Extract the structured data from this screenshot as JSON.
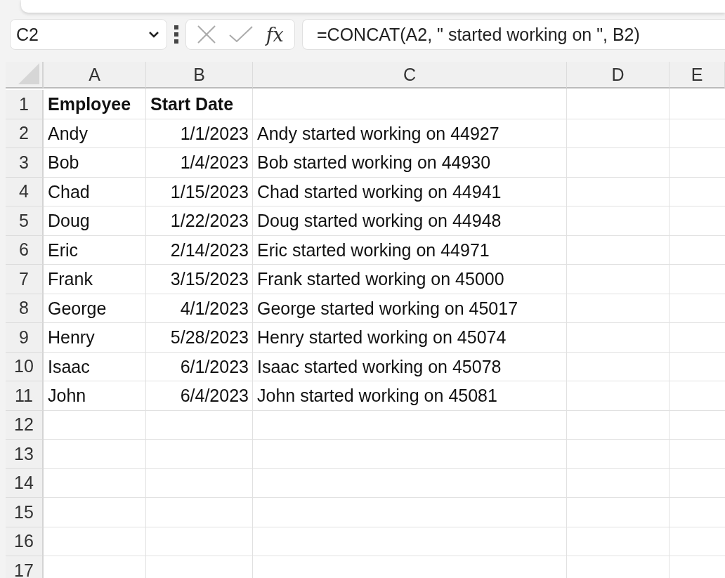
{
  "formula_bar": {
    "name_box": "C2",
    "function_label": "fx",
    "formula": "=CONCAT(A2, \" started working on \", B2)"
  },
  "sheet": {
    "columns": [
      "A",
      "B",
      "C",
      "D",
      "E"
    ],
    "header_row": {
      "number": "1",
      "cells": [
        "Employee",
        "Start Date"
      ]
    },
    "rows": [
      {
        "number": "2",
        "cells": [
          "Andy",
          "1/1/2023",
          "Andy started working on 44927"
        ]
      },
      {
        "number": "3",
        "cells": [
          "Bob",
          "1/4/2023",
          "Bob started working on 44930"
        ]
      },
      {
        "number": "4",
        "cells": [
          "Chad",
          "1/15/2023",
          "Chad started working on 44941"
        ]
      },
      {
        "number": "5",
        "cells": [
          "Doug",
          "1/22/2023",
          "Doug started working on 44948"
        ]
      },
      {
        "number": "6",
        "cells": [
          "Eric",
          "2/14/2023",
          "Eric started working on 44971"
        ]
      },
      {
        "number": "7",
        "cells": [
          "Frank",
          "3/15/2023",
          "Frank started working on 45000"
        ]
      },
      {
        "number": "8",
        "cells": [
          "George",
          "4/1/2023",
          "George started working on 45017"
        ]
      },
      {
        "number": "9",
        "cells": [
          "Henry",
          "5/28/2023",
          "Henry started working on 45074"
        ]
      },
      {
        "number": "10",
        "cells": [
          "Isaac",
          "6/1/2023",
          "Isaac started working on 45078"
        ]
      },
      {
        "number": "11",
        "cells": [
          "John",
          "6/4/2023",
          "John started working on 45081"
        ]
      },
      {
        "number": "12"
      },
      {
        "number": "13"
      },
      {
        "number": "14"
      },
      {
        "number": "15"
      },
      {
        "number": "16"
      },
      {
        "number": "17"
      }
    ]
  }
}
